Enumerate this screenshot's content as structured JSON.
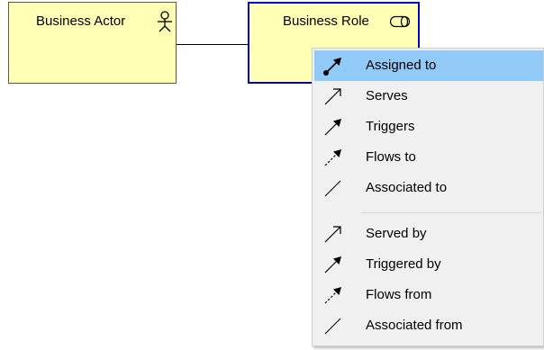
{
  "diagram": {
    "elements": [
      {
        "id": "actor",
        "label": "Business Actor",
        "icon": "business-actor-icon"
      },
      {
        "id": "role",
        "label": "Business Role",
        "icon": "business-role-icon"
      }
    ]
  },
  "context_menu": {
    "groups": [
      [
        {
          "label": "Assigned to",
          "icon": "assignment-relation-icon",
          "selected": true
        },
        {
          "label": "Serves",
          "icon": "serving-relation-icon"
        },
        {
          "label": "Triggers",
          "icon": "triggering-relation-icon"
        },
        {
          "label": "Flows to",
          "icon": "flow-relation-icon"
        },
        {
          "label": "Associated to",
          "icon": "association-relation-icon"
        }
      ],
      [
        {
          "label": "Served by",
          "icon": "serving-relation-icon"
        },
        {
          "label": "Triggered by",
          "icon": "triggering-relation-icon"
        },
        {
          "label": "Flows from",
          "icon": "flow-relation-icon"
        },
        {
          "label": "Associated from",
          "icon": "association-relation-icon"
        }
      ]
    ]
  },
  "colors": {
    "element_fill": "#ffffb5",
    "selection_border": "#0000cc",
    "menu_highlight": "#91c9f7"
  }
}
